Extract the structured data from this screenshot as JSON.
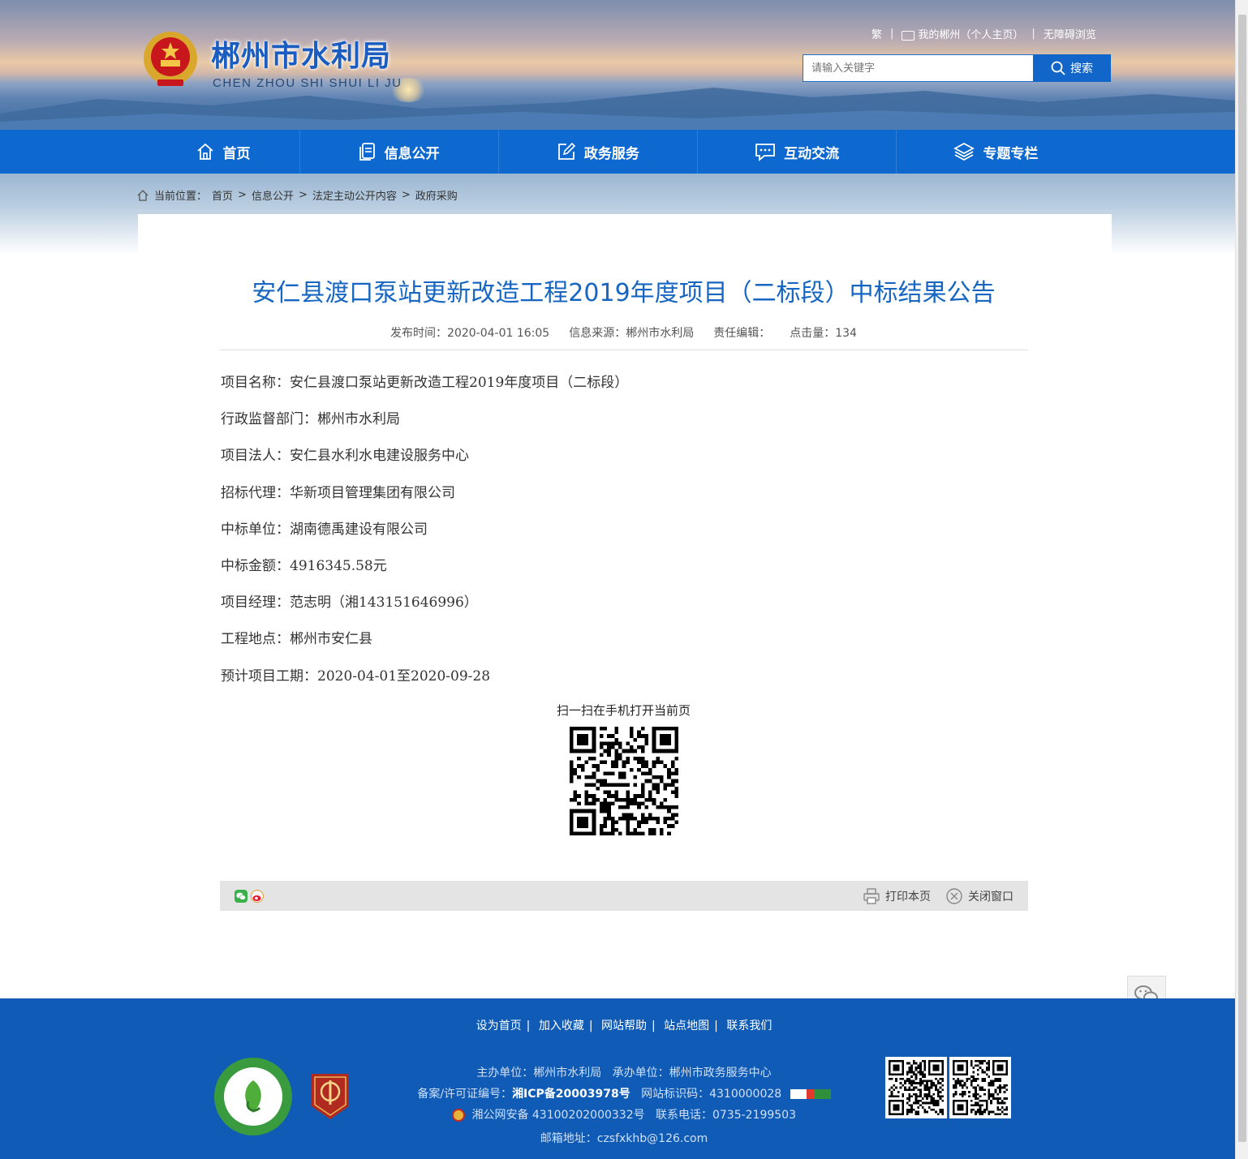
{
  "header": {
    "site_title": "郴州市水利局",
    "site_subtitle": "CHEN ZHOU SHI SHUI LI JU",
    "top_links": {
      "traditional": "繁",
      "my_chenzhou": "我的郴州（个人主页）",
      "accessible": "无障碍浏览"
    },
    "search": {
      "placeholder": "请输入关键字",
      "button_label": "搜索"
    }
  },
  "nav": {
    "items": [
      {
        "label": "首页",
        "icon": "home-icon"
      },
      {
        "label": "信息公开",
        "icon": "document-icon"
      },
      {
        "label": "政务服务",
        "icon": "edit-icon"
      },
      {
        "label": "互动交流",
        "icon": "chat-icon"
      },
      {
        "label": "专题专栏",
        "icon": "layers-icon"
      }
    ]
  },
  "breadcrumb": {
    "prefix": "当前位置：",
    "items": [
      "首页",
      "信息公开",
      "法定主动公开内容",
      "政府采购"
    ],
    "separator": ">"
  },
  "article": {
    "title": "安仁县渡口泵站更新改造工程2019年度项目（二标段）中标结果公告",
    "meta": {
      "publish_time": "发布时间：2020-04-01 16:05",
      "source": "信息来源：郴州市水利局",
      "editor": "责任编辑：",
      "clicks": "点击量：134"
    },
    "fields": [
      {
        "key": "项目名称：",
        "value": "安仁县渡口泵站更新改造工程2019年度项目（二标段）"
      },
      {
        "key": "行政监督部门：",
        "value": "郴州市水利局"
      },
      {
        "key": "项目法人：",
        "value": "安仁县水利水电建设服务中心"
      },
      {
        "key": "招标代理：",
        "value": "华新项目管理集团有限公司"
      },
      {
        "key": "中标单位：",
        "value": "湖南德禹建设有限公司"
      },
      {
        "key": "中标金额：",
        "value": "4916345.58元"
      },
      {
        "key": "项目经理：",
        "value": "范志明（湘143151646996）"
      },
      {
        "key": "工程地点：",
        "value": "郴州市安仁县"
      },
      {
        "key": "预计项目工期：",
        "value": "2020-04-01至2020-09-28"
      }
    ],
    "qr_caption": "扫一扫在手机打开当前页"
  },
  "share_bar": {
    "print_label": "打印本页",
    "close_label": "关闭窗口"
  },
  "footer": {
    "links": [
      "设为首页",
      "加入收藏",
      "网站帮助",
      "站点地图",
      "联系我们"
    ],
    "sponsor": "主办单位：郴州市水利局",
    "organizer": "承办单位：郴州市政务服务中心",
    "icp_label": "备案/许可证编号：",
    "icp_value": "湘ICP备20003978号",
    "site_id": "网站标识码：4310000028",
    "police": "湘公网安备 43100202000332号",
    "phone": "联系电话：0735-2199503",
    "email": "邮箱地址：czsfxkhb@126.com"
  },
  "colors": {
    "nav_blue": "#0d68cf",
    "title_blue": "#1766c2",
    "footer_blue": "#0f5bb5"
  }
}
